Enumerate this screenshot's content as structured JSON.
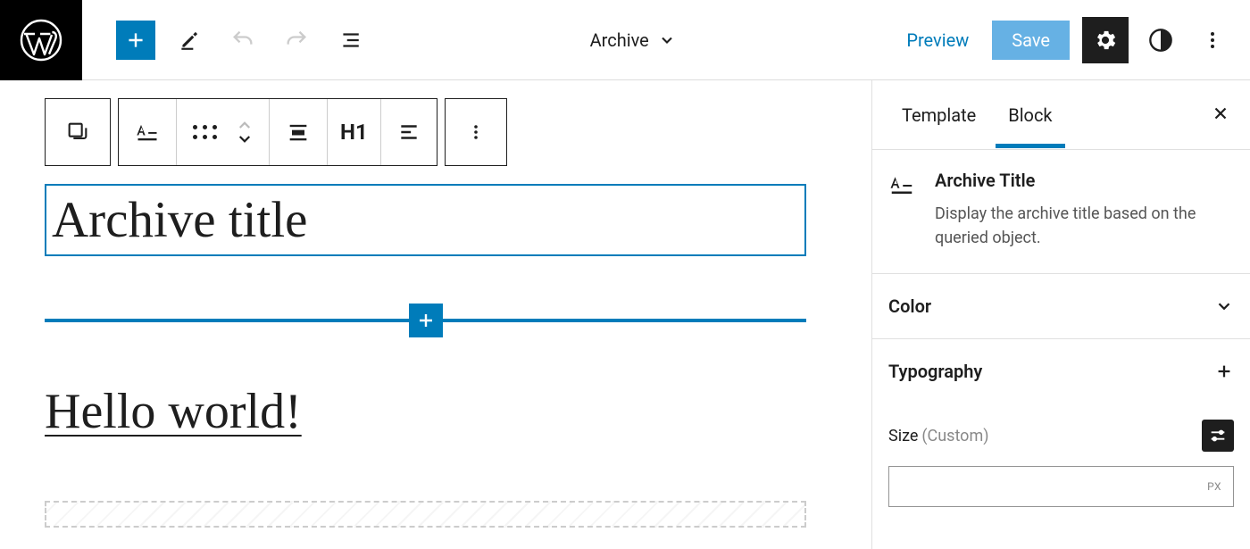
{
  "topbar": {
    "template_name": "Archive",
    "preview_label": "Preview",
    "save_label": "Save"
  },
  "block_toolbar": {
    "heading_level": "H1"
  },
  "canvas": {
    "archive_title": "Archive title",
    "post_title": "Hello world!"
  },
  "sidebar": {
    "tabs": {
      "template": "Template",
      "block": "Block"
    },
    "block_info": {
      "name": "Archive Title",
      "description": "Display the archive title based on the queried object."
    },
    "panels": {
      "color": "Color",
      "typography": "Typography",
      "size_label": "Size",
      "size_suffix": "(Custom)",
      "size_unit": "PX"
    }
  }
}
